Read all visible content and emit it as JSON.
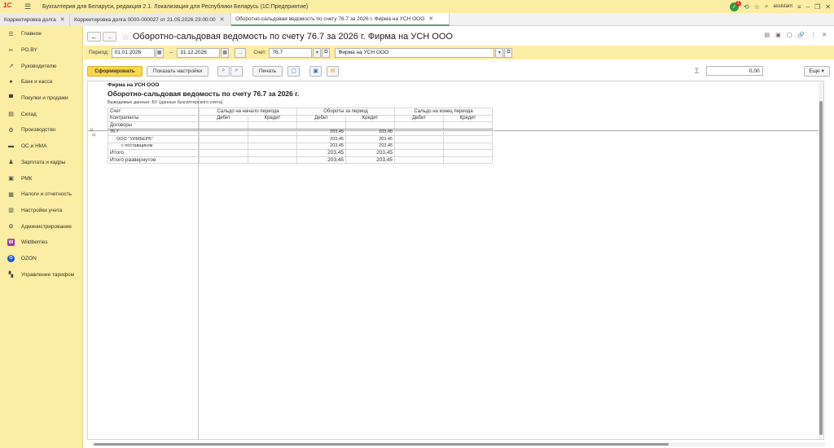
{
  "app": {
    "title": "Бухгалтерия для Беларуси, редакция 2.1. Локализация для Республики Беларусь   (1С:Предприятие)",
    "logo": "1С",
    "user": "assistant",
    "notif_count": "1"
  },
  "tabs": [
    {
      "label": "Корректировка долга"
    },
    {
      "label": "Корректировка долга 0000-000027 от 21.05.2026 23:00:00"
    },
    {
      "label": "Оборотно-сальдовая ведомость по счету 76.7 за 2026 г. Фирма на УСН ООО"
    }
  ],
  "sidebar": {
    "items": [
      {
        "label": "Главное",
        "icon": "menu-list-icon"
      },
      {
        "label": "PO.BY",
        "icon": "tools-icon"
      },
      {
        "label": "Руководителю",
        "icon": "chart-line-icon"
      },
      {
        "label": "Банк и касса",
        "icon": "coins-icon"
      },
      {
        "label": "Покупки и продажи",
        "icon": "cart-icon"
      },
      {
        "label": "Склад",
        "icon": "warehouse-icon"
      },
      {
        "label": "Производство",
        "icon": "gear-icon"
      },
      {
        "label": "ОС и НМА",
        "icon": "car-icon"
      },
      {
        "label": "Зарплата и кадры",
        "icon": "people-icon"
      },
      {
        "label": "РМК",
        "icon": "register-icon"
      },
      {
        "label": "Налоги и отчетность",
        "icon": "tax-icon"
      },
      {
        "label": "Настройки учета",
        "icon": "book-icon"
      },
      {
        "label": "Администрирование",
        "icon": "gear-icon"
      },
      {
        "label": "Wildberries",
        "icon": "wildberries-icon"
      },
      {
        "label": "OZON",
        "icon": "ozon-icon"
      },
      {
        "label": "Управление тарифом",
        "icon": "grid-icon"
      }
    ]
  },
  "header": {
    "title": "Оборотно-сальдовая ведомость по счету 76.7 за 2026 г. Фирма на УСН ООО"
  },
  "period": {
    "label": "Период:",
    "from": "01.01.2026",
    "dash": "–",
    "to": "31.12.2026",
    "dots": "...",
    "account_label": "Счет:",
    "account": "76.7",
    "org": "Фирма на УСН ООО"
  },
  "toolbar": {
    "generate": "Сформировать",
    "settings": "Показать настройки",
    "print": "Печать",
    "sum_value": "0,00",
    "more": "Еще"
  },
  "report": {
    "org": "Фирма на УСН ООО",
    "title": "Оборотно-сальдовая ведомость по счету 76.7 за 2026 г.",
    "subtitle": "Выводимые данные:  БУ (данные бухгалтерского учета)",
    "hdr_account": "Счет",
    "hdr_contractors": "Контрагенты",
    "hdr_contracts": "Договоры",
    "grp_open": "Сальдо на начало периода",
    "grp_turn": "Обороты за период",
    "grp_close": "Сальдо на конец периода",
    "debit": "Дебет",
    "credit": "Кредит",
    "rows": [
      {
        "name": "76.7",
        "turn_debit": "203,45",
        "turn_credit": "203,45"
      },
      {
        "name": "ООО \"УИМБЕРБ\"",
        "turn_debit": "203,45",
        "turn_credit": "203,45"
      },
      {
        "name": "с поставщиком",
        "turn_debit": "203,45",
        "turn_credit": "203,45"
      },
      {
        "name": "Итого",
        "turn_debit": "203,45",
        "turn_credit": "203,45"
      },
      {
        "name": "Итого развернутое",
        "turn_debit": "203,45",
        "turn_credit": "203,45"
      }
    ]
  }
}
